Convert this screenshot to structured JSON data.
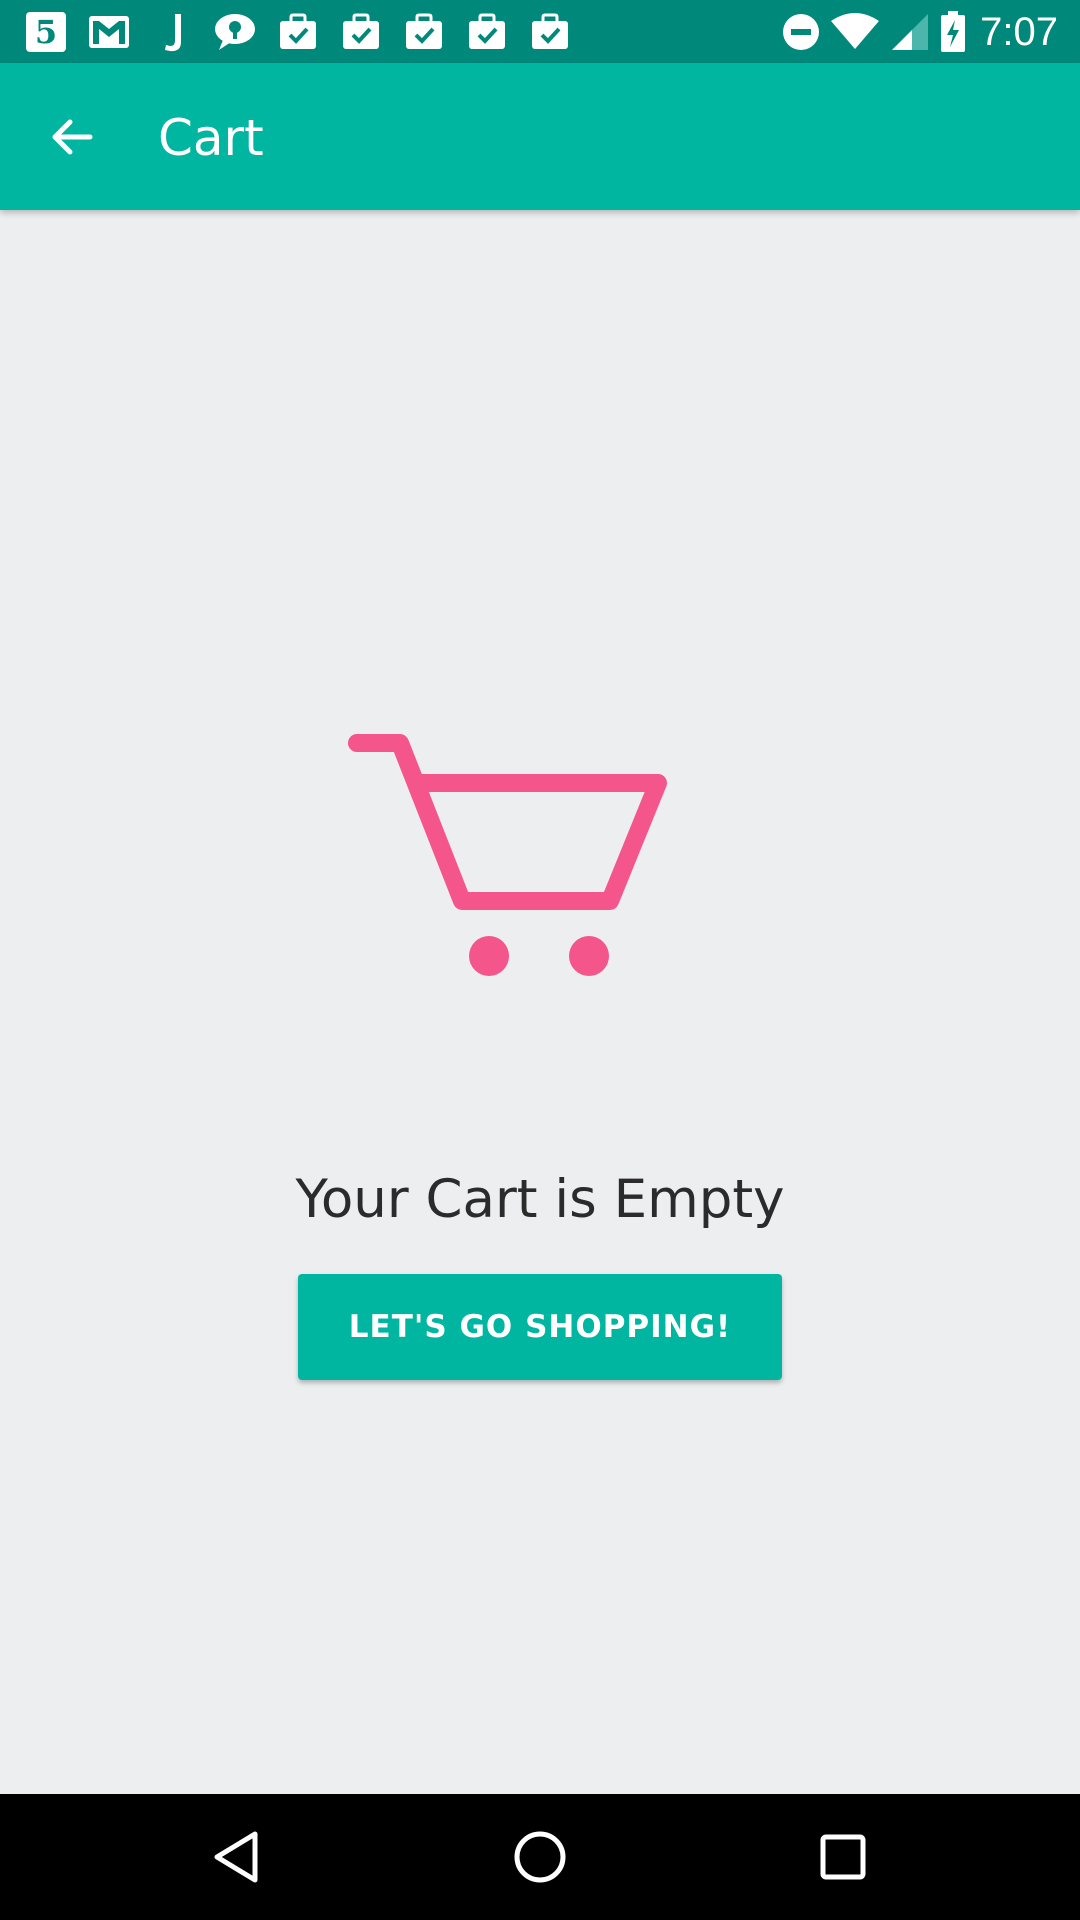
{
  "status_bar": {
    "time": "7:07",
    "left_icons": [
      "channel5-icon",
      "gmail-icon",
      "j-app-icon",
      "messenger-icon",
      "task-bag-icon",
      "task-bag-icon",
      "task-bag-icon",
      "task-bag-icon",
      "task-bag-icon"
    ],
    "right_icons": [
      "do-not-disturb-icon",
      "wifi-icon",
      "cell-signal-icon",
      "battery-charging-icon"
    ],
    "background_color": "#00897b"
  },
  "app_bar": {
    "title": "Cart",
    "back_icon": "arrow-back-icon",
    "background_color": "#00b6a1"
  },
  "content": {
    "illustration_icon": "shopping-cart-icon",
    "illustration_color": "#f4568b",
    "empty_message": "Your Cart is Empty",
    "shop_button_label": "LET'S GO SHOPPING!",
    "background_color": "#eceef0"
  },
  "nav_bar": {
    "buttons": [
      "back-triangle-icon",
      "home-circle-icon",
      "recents-square-icon"
    ]
  }
}
